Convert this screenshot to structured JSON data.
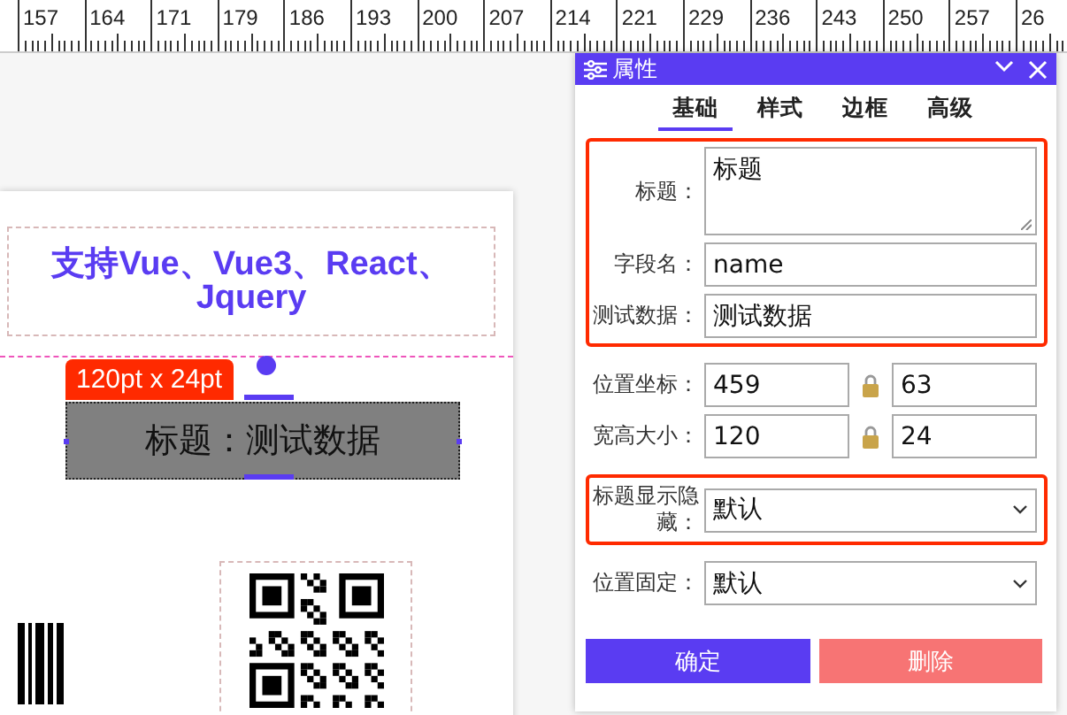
{
  "ruler": {
    "labels": [
      "157",
      "164",
      "171",
      "179",
      "186",
      "193",
      "200",
      "207",
      "214",
      "221",
      "229",
      "236",
      "243",
      "250",
      "257",
      "26"
    ]
  },
  "canvas": {
    "text_element": {
      "text": "支持Vue、Vue3、React、Jquery"
    },
    "size_badge": "120pt x 24pt",
    "selected_element": {
      "text": "标题：测试数据",
      "selected": true
    }
  },
  "panel": {
    "title": "属性",
    "tabs": [
      {
        "label": "基础",
        "selected": true
      },
      {
        "label": "样式",
        "selected": false
      },
      {
        "label": "边框",
        "selected": false
      },
      {
        "label": "高级",
        "selected": false
      }
    ],
    "sections": [
      {
        "highlighted": true,
        "fields": [
          {
            "kind": "textarea",
            "label": "标题：",
            "value": "标题"
          },
          {
            "kind": "text",
            "label": "字段名：",
            "value": "name"
          },
          {
            "kind": "text",
            "label": "测试数据：",
            "value": "测试数据"
          }
        ]
      },
      {
        "highlighted": false,
        "fields": [
          {
            "kind": "pair",
            "label": "位置坐标：",
            "values": [
              "459",
              "63"
            ]
          },
          {
            "kind": "pair",
            "label": "宽高大小：",
            "values": [
              "120",
              "24"
            ]
          }
        ]
      },
      {
        "highlighted": true,
        "fields": [
          {
            "kind": "select",
            "label": "标题显示隐藏：",
            "value": "默认"
          }
        ]
      },
      {
        "highlighted": false,
        "fields": [
          {
            "kind": "select",
            "label": "位置固定：",
            "value": "默认"
          }
        ]
      }
    ],
    "buttons": [
      {
        "label": "确定",
        "kind": "primary"
      },
      {
        "label": "删除",
        "kind": "danger"
      }
    ]
  }
}
